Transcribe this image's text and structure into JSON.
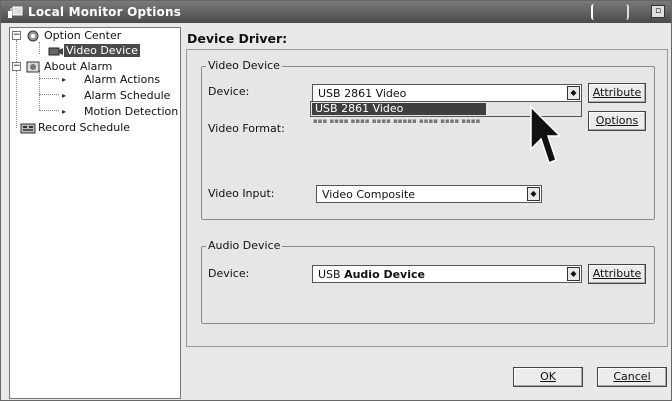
{
  "window": {
    "title": "Local Monitor Options",
    "maximize_glyph": "▫"
  },
  "tree": {
    "items": [
      {
        "label": "Option Center",
        "icon": "option-center-icon"
      },
      {
        "label": "Video Device",
        "icon": "video-device-icon",
        "selected": true
      },
      {
        "label": "About Alarm",
        "icon": "alarm-icon"
      },
      {
        "label": "Alarm Actions"
      },
      {
        "label": "Alarm Schedule"
      },
      {
        "label": "Motion Detection"
      },
      {
        "label": "Record Schedule",
        "icon": "record-schedule-icon"
      }
    ]
  },
  "heading": "Device Driver:",
  "video_device": {
    "legend": "Video Device",
    "device_label": "Device:",
    "device_value": "USB 2861 Video",
    "attribute_label": "Attribute",
    "dropdown_option": "USB 2861 Video",
    "format_label": "Video Format:",
    "options_label": "Options",
    "input_label": "Video Input:",
    "input_value": "Video Composite"
  },
  "audio_device": {
    "legend": "Audio Device",
    "device_label": "Device:",
    "device_prefix": "USB ",
    "device_bold": "Audio Device",
    "attribute_label": "Attribute"
  },
  "footer": {
    "ok_label": "OK",
    "cancel_label": "Cancel"
  },
  "colors": {
    "title_bar": "#555555",
    "selection": "#4a4a4a",
    "panel": "#e6e6e6"
  }
}
